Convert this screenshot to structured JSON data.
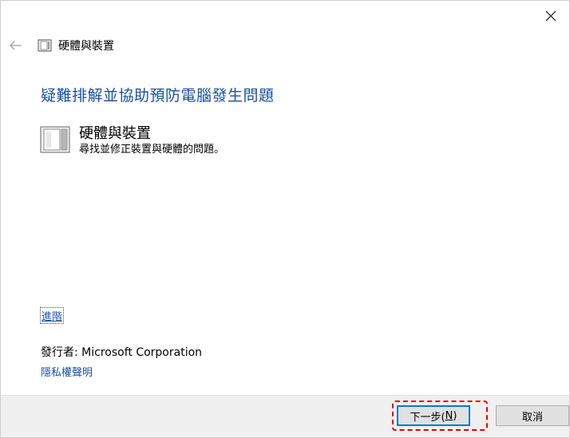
{
  "window": {
    "title": "硬體與裝置"
  },
  "main": {
    "heading": "疑難排解並協助預防電腦發生問題",
    "item": {
      "name": "硬體與裝置",
      "description": "尋找並修正裝置與硬體的問題。"
    },
    "advanced_link": "進階",
    "publisher": "發行者:  Microsoft Corporation",
    "privacy_link": "隱私權聲明"
  },
  "footer": {
    "next_label": "下一步(",
    "next_mnemonic": "N",
    "next_suffix": ")",
    "cancel_label": "取消"
  },
  "colors": {
    "link": "#1a4fa3",
    "highlight": "#e60000",
    "footer_bg": "#f0f0f0"
  }
}
